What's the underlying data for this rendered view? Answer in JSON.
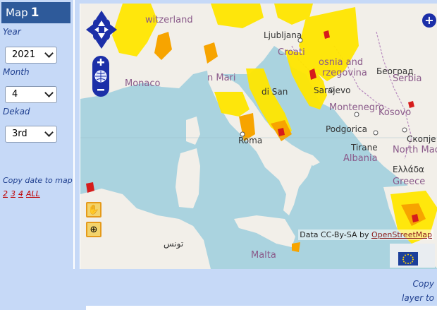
{
  "sidebar": {
    "title": "Map",
    "map_number": "1",
    "year_label": "Year",
    "year_value": "2021",
    "month_label": "Month",
    "month_value": "4",
    "dekad_label": "Dekad",
    "dekad_value": "3rd",
    "copy_date_label": "Copy date to map",
    "copy_targets": [
      "2",
      "3",
      "4",
      "ALL"
    ]
  },
  "map": {
    "places": {
      "switzerland": "witzerland",
      "ljubljana": "Ljubljana",
      "croatia": "Croati",
      "bosnia": "osnia and",
      "herzegovina": "rzegovina",
      "belgrade": "Београд",
      "serbia": "Serbia",
      "monaco": "Monaco",
      "sanmarino_a": "n Mari",
      "sanmarino_b": "di San",
      "sarajevo": "Sarajevo",
      "montenegro": "Montenegro",
      "kosovo": "Kosovo",
      "podgorica": "Podgorica",
      "skopje": "Скопје",
      "north_mac": "North Mac",
      "roma": "Roma",
      "tirane": "Tirane",
      "albania": "Albania",
      "greece": "Ελλάδα",
      "greece2": "Greece",
      "tunisia": "تونس",
      "malta": "Malta"
    },
    "attribution_prefix": "Data CC-By-SA by ",
    "attribution_link": "OpenStreetMap",
    "plus_symbol": "+"
  },
  "bottom": {
    "copy_label": "Copy",
    "layer_label": "layer to"
  },
  "icons": {
    "pan": "hand-icon",
    "zoombox": "zoom-box-icon"
  }
}
